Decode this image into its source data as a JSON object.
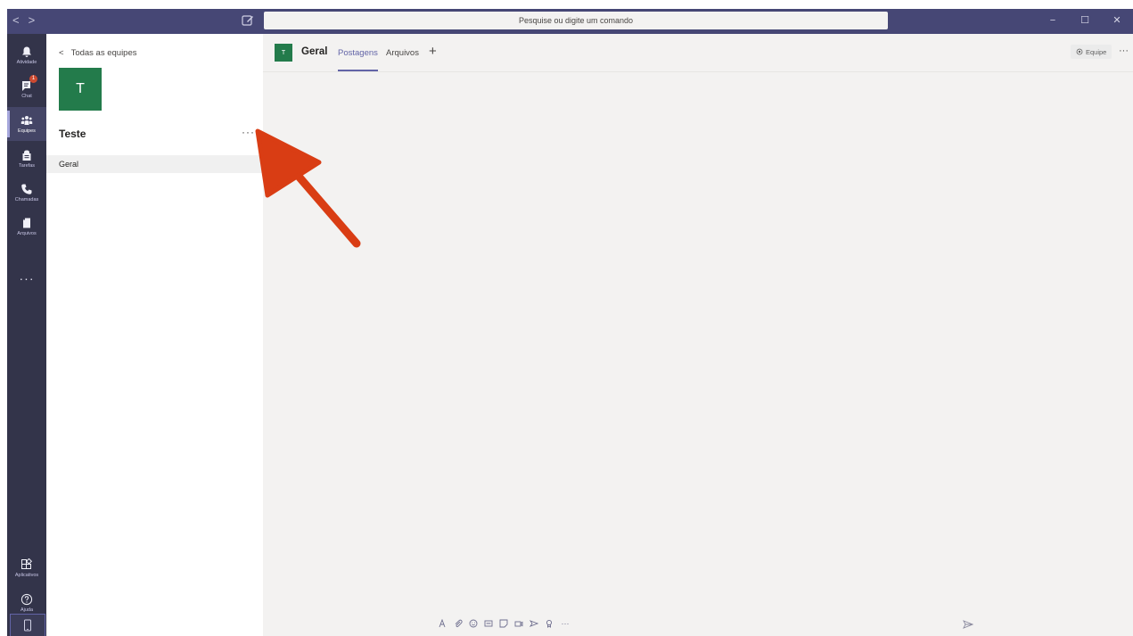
{
  "titlebar": {
    "back": "<",
    "forward": ">",
    "search_placeholder": "Pesquise ou digite um comando",
    "minimize": "−",
    "maximize": "☐",
    "close": "✕"
  },
  "rail": {
    "items": [
      {
        "label": "Atividade",
        "icon": "bell-icon"
      },
      {
        "label": "Chat",
        "icon": "chat-icon",
        "badge": "1"
      },
      {
        "label": "Equipes",
        "icon": "teams-icon",
        "active": true
      },
      {
        "label": "Tarefas",
        "icon": "tasks-icon"
      },
      {
        "label": "Chamadas",
        "icon": "phone-icon"
      },
      {
        "label": "Arquivos",
        "icon": "files-icon"
      }
    ],
    "more": "···",
    "apps_label": "Aplicativos",
    "help_label": "Ajuda"
  },
  "panel": {
    "back_label": "Todas as equipes",
    "team_initial": "T",
    "team_name": "Teste",
    "more": "···",
    "channels": [
      {
        "name": "Geral"
      }
    ]
  },
  "main": {
    "channel_initial": "T",
    "channel_title": "Geral",
    "tabs": [
      {
        "label": "Postagens",
        "active": true
      },
      {
        "label": "Arquivos"
      }
    ],
    "add_tab": "+",
    "team_button": "Equipe",
    "more": "···",
    "composer_more": "···"
  },
  "colors": {
    "titlebar": "#464775",
    "rail": "#33344a",
    "accent": "#6264a7",
    "team_green": "#237b4b",
    "annotation_arrow": "#d93d14"
  }
}
